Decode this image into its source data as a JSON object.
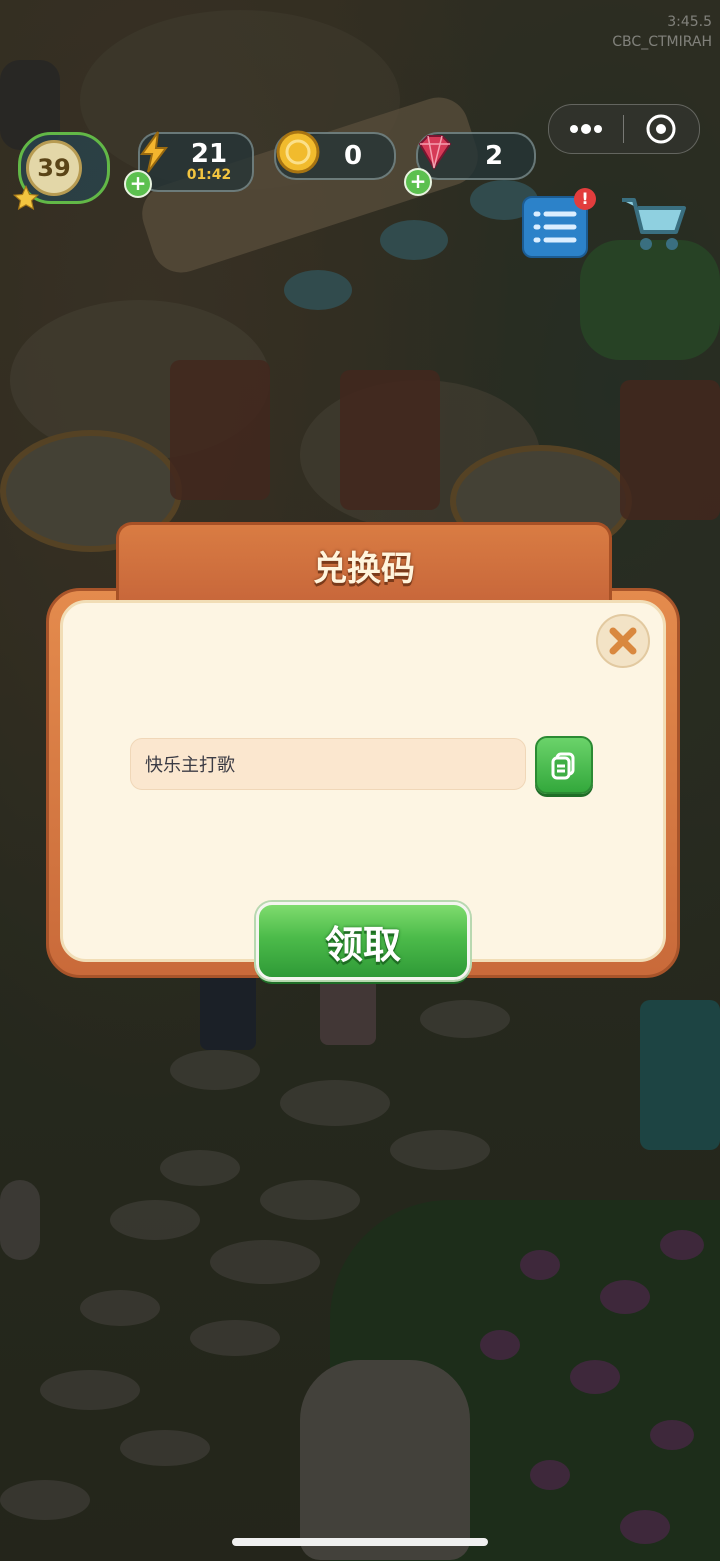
{
  "overlay": {
    "time": "3:45.5",
    "code": "CBC_CTMIRAH"
  },
  "hud": {
    "level": "39",
    "energy": "21",
    "energy_timer": "01:42",
    "coins": "0",
    "gems": "2"
  },
  "dialog": {
    "title": "兑换码",
    "input_value": "快乐主打歌",
    "claim_label": "领取"
  },
  "colors": {
    "dialog_orange": "#d97c43",
    "panel_cream": "#fdf5e3",
    "button_green": "#4cbb4a"
  },
  "icons": [
    "more-dots-icon",
    "target-icon",
    "lightning-icon",
    "coin-icon",
    "gem-icon",
    "task-list-icon",
    "cart-icon",
    "close-icon",
    "paste-icon",
    "star-icon",
    "plus-icon"
  ]
}
